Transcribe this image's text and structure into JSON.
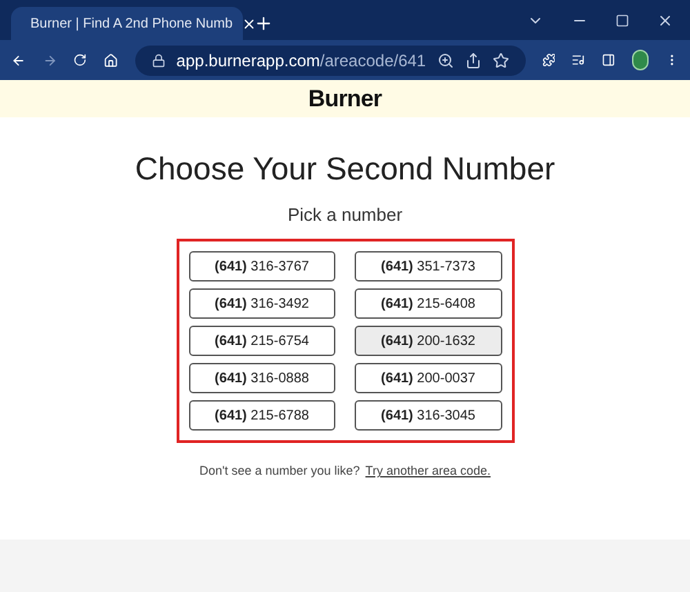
{
  "browser": {
    "tab_title": "Burner | Find A 2nd Phone Numb",
    "url_host": "app.burnerapp.com",
    "url_path": "/areacode/641"
  },
  "brand": "Burner",
  "heading": "Choose Your Second Number",
  "subheading": "Pick a number",
  "numbers": [
    {
      "label": "**(641)** 316-3767",
      "hovered": false
    },
    {
      "label": "**(641)** 351-7373",
      "hovered": false
    },
    {
      "label": "**(641)** 316-3492",
      "hovered": false
    },
    {
      "label": "**(641)** 215-6408",
      "hovered": false
    },
    {
      "label": "**(641)** 215-6754",
      "hovered": false
    },
    {
      "label": "**(641)** 200-1632",
      "hovered": true
    },
    {
      "label": "**(641)** 316-0888",
      "hovered": false
    },
    {
      "label": "**(641)** 200-0037",
      "hovered": false
    },
    {
      "label": "**(641)** 215-6788",
      "hovered": false
    },
    {
      "label": "**(641)** 316-3045",
      "hovered": false
    }
  ],
  "footer_text": "Don't see a number you like?",
  "footer_link": "Try another area code."
}
